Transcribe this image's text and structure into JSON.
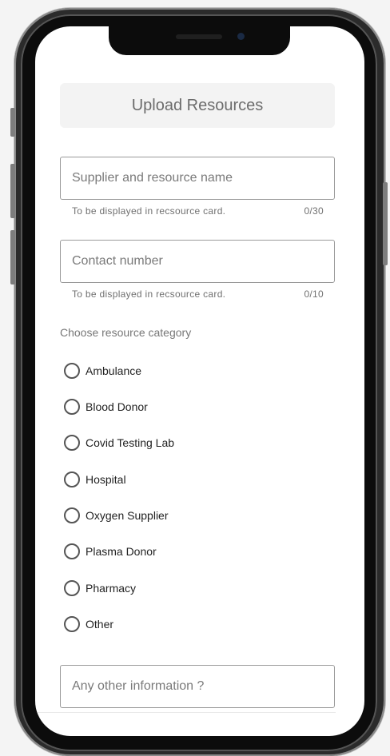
{
  "header": {
    "title": "Upload Resources"
  },
  "form": {
    "name_field": {
      "placeholder": "Supplier and resource name",
      "helper": "To be displayed in recsource card.",
      "counter": "0/30"
    },
    "contact_field": {
      "placeholder": "Contact number",
      "helper": "To be displayed in recsource card.",
      "counter": "0/10"
    },
    "category_label": "Choose resource category",
    "categories": [
      {
        "label": "Ambulance"
      },
      {
        "label": "Blood Donor"
      },
      {
        "label": "Covid Testing Lab"
      },
      {
        "label": "Hospital"
      },
      {
        "label": "Oxygen Supplier"
      },
      {
        "label": "Plasma Donor"
      },
      {
        "label": "Pharmacy"
      },
      {
        "label": "Other"
      }
    ],
    "info_field": {
      "placeholder": "Any other information ?"
    }
  }
}
